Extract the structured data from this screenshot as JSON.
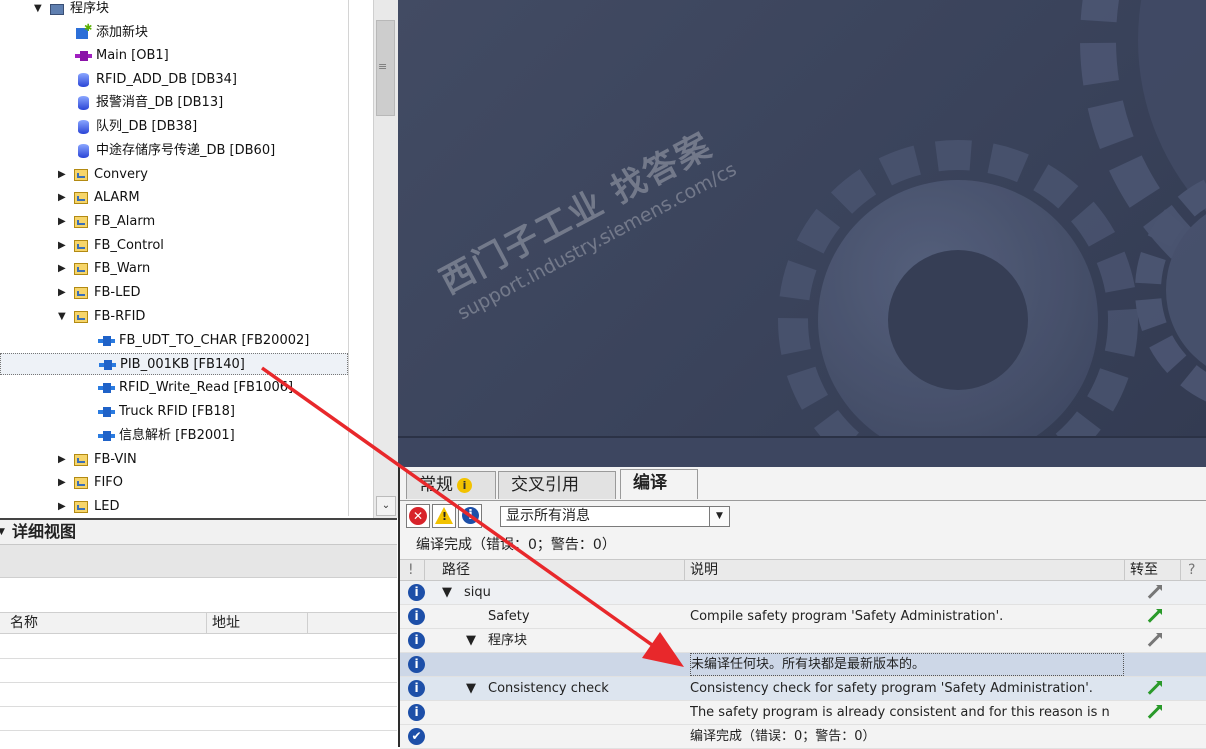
{
  "tree": {
    "items": [
      {
        "label": "程序块",
        "icon": "program-blocks-folder-icon",
        "expanded": true
      },
      {
        "label": "添加新块",
        "icon": "add-new-block-icon"
      },
      {
        "label": "Main [OB1]",
        "icon": "ob-block-icon"
      },
      {
        "label": "RFID_ADD_DB [DB34]",
        "icon": "db-block-icon"
      },
      {
        "label": "报警消音_DB [DB13]",
        "icon": "db-block-icon"
      },
      {
        "label": "队列_DB [DB38]",
        "icon": "db-block-icon"
      },
      {
        "label": "中途存储序号传递_DB [DB60]",
        "icon": "db-block-icon"
      },
      {
        "label": "Convery",
        "icon": "folder-icon"
      },
      {
        "label": "ALARM",
        "icon": "folder-icon"
      },
      {
        "label": "FB_Alarm",
        "icon": "folder-icon"
      },
      {
        "label": "FB_Control",
        "icon": "folder-icon"
      },
      {
        "label": "FB_Warn",
        "icon": "folder-icon"
      },
      {
        "label": "FB-LED",
        "icon": "folder-icon"
      },
      {
        "label": "FB-RFID",
        "icon": "folder-icon",
        "expanded": true
      },
      {
        "label": "FB_UDT_TO_CHAR [FB20002]",
        "icon": "fb-block-icon"
      },
      {
        "label": "PIB_001KB [FB140]",
        "icon": "fb-block-icon",
        "selected": true
      },
      {
        "label": "RFID_Write_Read [FB1006]",
        "icon": "fb-block-icon"
      },
      {
        "label": "Truck RFID [FB18]",
        "icon": "fb-block-icon"
      },
      {
        "label": "信息解析 [FB2001]",
        "icon": "fb-block-icon"
      },
      {
        "label": "FB-VIN",
        "icon": "folder-icon"
      },
      {
        "label": "FIFO",
        "icon": "folder-icon"
      },
      {
        "label": "LED",
        "icon": "folder-icon"
      }
    ]
  },
  "detail_view": {
    "title": "详细视图",
    "columns": [
      "名称",
      "地址"
    ]
  },
  "watermark": {
    "line1": "西门子工业  找答案",
    "line2": "support.industry.siemens.com/cs"
  },
  "inspector": {
    "tabs": [
      "常规",
      "交叉引用",
      "编译"
    ],
    "active_tab": "编译",
    "filter_value": "显示所有消息",
    "summary": "编译完成（错误：0；警告：0）",
    "columns": {
      "flag": "!",
      "path": "路径",
      "description": "说明",
      "goto": "转至",
      "help": "?"
    },
    "rows": [
      {
        "icon": "info-icon",
        "path": "siqu",
        "expander": "▼",
        "description": "",
        "goto": "grey"
      },
      {
        "icon": "info-icon",
        "path": "Safety",
        "expander": "",
        "description": "Compile safety program 'Safety Administration'.",
        "goto": "green"
      },
      {
        "icon": "info-icon",
        "path": "程序块",
        "expander": "▼",
        "description": "",
        "goto": "grey"
      },
      {
        "icon": "info-icon",
        "path": "",
        "expander": "",
        "description": "未编译任何块。所有块都是最新版本的。",
        "goto": "none"
      },
      {
        "icon": "info-icon",
        "path": "Consistency check",
        "expander": "▼",
        "description": "Consistency check for safety program 'Safety Administration'.",
        "goto": "green"
      },
      {
        "icon": "info-icon",
        "path": "",
        "expander": "",
        "description": "The safety program is already consistent and for this reason is n",
        "goto": "green"
      },
      {
        "icon": "check-icon",
        "path": "",
        "expander": "",
        "description": "编译完成（错误：0；警告：0）",
        "goto": "none"
      }
    ]
  },
  "colors": {
    "banner": "#3a435b",
    "annotation_arrow": "#e8282b",
    "goto_green": "#2a9a2a"
  }
}
